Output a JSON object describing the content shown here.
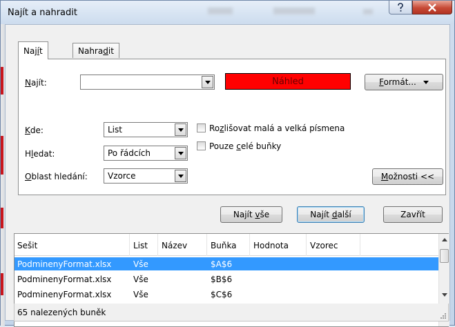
{
  "window": {
    "title": "Najít a nahradit"
  },
  "tabs": [
    {
      "pre": "Naj",
      "key": "í",
      "post": "t"
    },
    {
      "pre": "Nahra",
      "key": "d",
      "post": "it"
    }
  ],
  "find": {
    "label_pre": "",
    "label_key": "N",
    "label_post": "ajít:",
    "value": "",
    "preview": "Náhled",
    "format_pre": "",
    "format_key": "F",
    "format_post": "ormát..."
  },
  "options": {
    "within": {
      "label_pre": "",
      "label_key": "K",
      "label_post": "de:",
      "value": "List"
    },
    "search": {
      "label_pre": "H",
      "label_key": "l",
      "label_post": "edat:",
      "value": "Po řádcích"
    },
    "lookin": {
      "label_pre": "",
      "label_key": "O",
      "label_post": "blast hledání:",
      "value": "Vzorce"
    },
    "match_case": {
      "pre": "Ro",
      "key": "z",
      "post": "lišovat malá a velká písmena"
    },
    "match_entire": {
      "pre": "Pouze ",
      "key": "c",
      "post": "elé buňky"
    },
    "options_button": {
      "pre": "",
      "key": "M",
      "post": "ožnosti <<"
    }
  },
  "actions": {
    "find_all": {
      "pre": "Najít ",
      "key": "v",
      "post": "še"
    },
    "find_next": {
      "pre": "Najít ",
      "key": "d",
      "post": "alší"
    },
    "close": "Zavřít"
  },
  "results": {
    "columns": [
      "Sešit",
      "List",
      "Název",
      "Buňka",
      "Hodnota",
      "Vzorec"
    ],
    "rows": [
      {
        "book": "PodminenyFormat.xlsx",
        "sheet": "Vše",
        "name": "",
        "cell": "$A$6",
        "value": "",
        "formula": ""
      },
      {
        "book": "PodminenyFormat.xlsx",
        "sheet": "Vše",
        "name": "",
        "cell": "$B$6",
        "value": "",
        "formula": ""
      },
      {
        "book": "PodminenyFormat.xlsx",
        "sheet": "Vše",
        "name": "",
        "cell": "$C$6",
        "value": "",
        "formula": ""
      }
    ],
    "status": "65 nalezených buněk"
  },
  "colors": {
    "preview_bg": "#ff0000",
    "selection": "#3399ff",
    "close_button": "#c74a36"
  }
}
